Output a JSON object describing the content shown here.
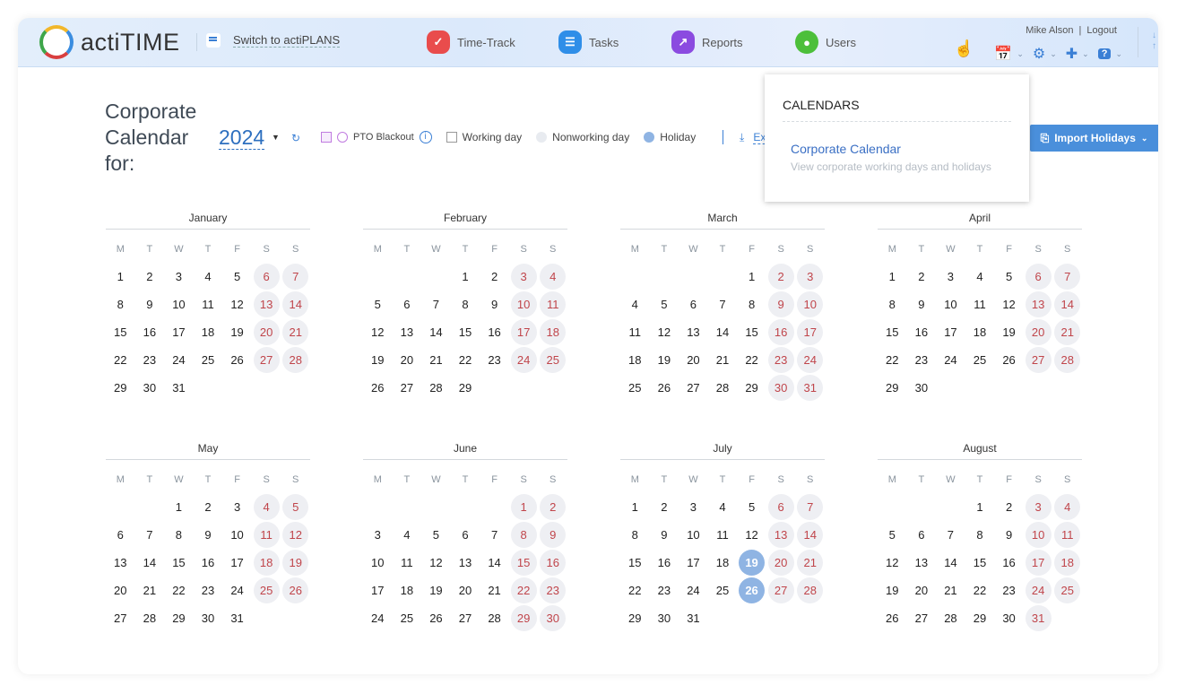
{
  "header": {
    "brand": "actiTIME",
    "switch_label": "Switch to actiPLANS",
    "nav": [
      {
        "label": "Time-Track",
        "icon": "check-icon",
        "color": "#e94c4c"
      },
      {
        "label": "Tasks",
        "icon": "list-icon",
        "color": "#2f8ee8"
      },
      {
        "label": "Reports",
        "icon": "chart-icon",
        "color": "#8b4be0"
      },
      {
        "label": "Users",
        "icon": "user-icon",
        "color": "#4cbf3a"
      }
    ],
    "user_name": "Mike Alson",
    "logout": "Logout"
  },
  "page": {
    "title": "Corporate Calendar for:",
    "year": "2024",
    "legend": {
      "pto": "PTO Blackout",
      "working": "Working day",
      "nonworking": "Nonworking day",
      "holiday": "Holiday"
    },
    "export_label": "Export",
    "import_label": "Import Holidays"
  },
  "dropdown": {
    "heading": "CALENDARS",
    "item_title": "Corporate Calendar",
    "item_desc": "View corporate working days and holidays"
  },
  "calendar": {
    "year": 2024,
    "weekdays": [
      "M",
      "T",
      "W",
      "T",
      "F",
      "S",
      "S"
    ],
    "months": [
      "January",
      "February",
      "March",
      "April",
      "May",
      "June",
      "July",
      "August"
    ],
    "holidays": [
      {
        "month": "July",
        "days": [
          19,
          26
        ]
      }
    ]
  },
  "colors": {
    "accent": "#3a7fd5",
    "weekend_text": "#c0454b",
    "holiday_fill": "#8fb4e3"
  }
}
